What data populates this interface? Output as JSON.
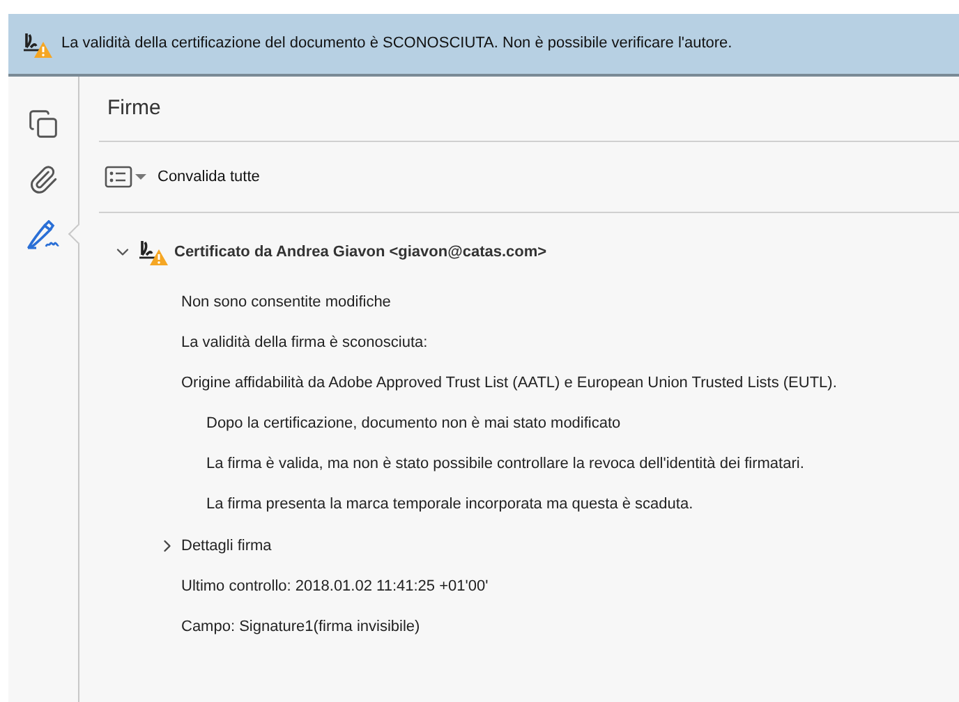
{
  "banner": {
    "text": "La validità della certificazione del documento è SCONOSCIUTA. Non è possibile verificare l'autore."
  },
  "sidebar": {
    "items": [
      {
        "kind": "pages",
        "selected": false
      },
      {
        "kind": "attachments",
        "selected": false
      },
      {
        "kind": "signatures",
        "selected": true
      }
    ]
  },
  "panel": {
    "title": "Firme",
    "toolbar": {
      "label": "Convalida tutte"
    }
  },
  "signature": {
    "title": "Certificato da Andrea Giavon <giavon@catas.com>",
    "expanded": true,
    "items": [
      {
        "kind": "text",
        "text": "Non sono consentite modifiche"
      },
      {
        "kind": "text",
        "text": "La validità della firma è sconosciuta:"
      },
      {
        "kind": "text",
        "text": "Origine affidabilità da Adobe Approved Trust List (AATL) e European Union Trusted Lists (EUTL).",
        "children": [
          {
            "kind": "text",
            "text": "Dopo la certificazione, documento non è mai stato modificato"
          },
          {
            "kind": "text",
            "text": "La firma è valida, ma non è stato possibile controllare la revoca dell'identità dei firmatari."
          },
          {
            "kind": "text",
            "text": "La firma presenta la marca temporale incorporata ma questa è scaduta."
          }
        ]
      },
      {
        "kind": "expander",
        "text": "Dettagli firma",
        "expanded": false
      },
      {
        "kind": "text",
        "text": "Ultimo controllo: 2018.01.02 11:41:25 +01'00'"
      },
      {
        "kind": "text",
        "text": "Campo: Signature1(firma invisibile)"
      }
    ]
  }
}
